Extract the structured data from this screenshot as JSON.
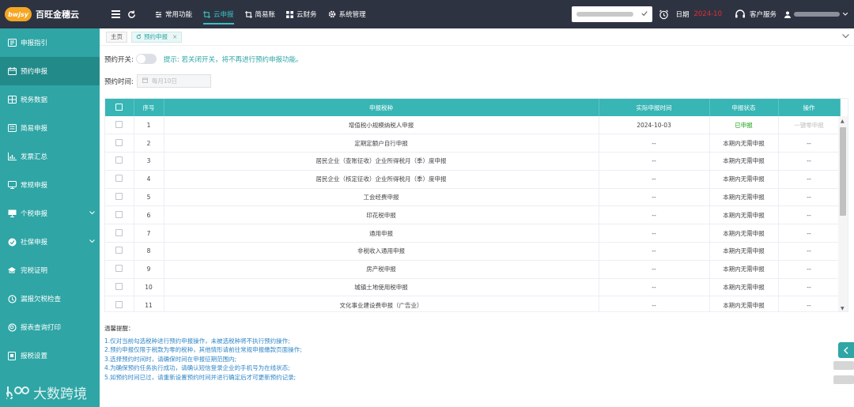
{
  "header": {
    "logo_badge": "bwjsy",
    "app_name": "百旺金穗云",
    "nav": [
      {
        "label": "常用功能",
        "icon": "tools-icon"
      },
      {
        "label": "云申报",
        "icon": "crop-icon"
      },
      {
        "label": "简易账",
        "icon": "crop-icon"
      },
      {
        "label": "云财务",
        "icon": "grid-icon"
      },
      {
        "label": "系统管理",
        "icon": "gear-icon"
      }
    ],
    "date_label": "日期",
    "date_value": "2024-10",
    "service_label": "客户服务"
  },
  "sidebar": {
    "items": [
      {
        "label": "申报指引"
      },
      {
        "label": "预约申报"
      },
      {
        "label": "税务数据"
      },
      {
        "label": "简易申报"
      },
      {
        "label": "发票汇总"
      },
      {
        "label": "常规申报"
      },
      {
        "label": "个税申报"
      },
      {
        "label": "社保申报"
      },
      {
        "label": "完税证明"
      },
      {
        "label": "漏报欠税检查"
      },
      {
        "label": "报表查询打印"
      },
      {
        "label": "报税设置"
      }
    ],
    "watermark": "大数跨境"
  },
  "tabs": [
    {
      "label": "主页"
    },
    {
      "label": "预约申报"
    }
  ],
  "form": {
    "switch_label": "预约开关:",
    "switch_hint": "提示: 若关闭开关，将不再进行预约申报功能。",
    "time_label": "预约时间:",
    "time_placeholder": "每月10日"
  },
  "table": {
    "headers": {
      "seq": "序号",
      "type": "申报税种",
      "time": "实际申报时间",
      "status": "申报状态",
      "op": "操作"
    },
    "rows": [
      {
        "seq": "1",
        "type": "增值税小规模纳税人申报",
        "time": "2024-10-03",
        "status": "已申报",
        "op": "一键零申报"
      },
      {
        "seq": "2",
        "type": "定期定额户自行申报",
        "time": "--",
        "status": "本期内无需申报",
        "op": "--"
      },
      {
        "seq": "3",
        "type": "居民企业（查账征收）企业所得税月（季）度申报",
        "time": "--",
        "status": "本期内无需申报",
        "op": "--"
      },
      {
        "seq": "4",
        "type": "居民企业（核定征收）企业所得税月（季）度申报",
        "time": "--",
        "status": "本期内无需申报",
        "op": "--"
      },
      {
        "seq": "5",
        "type": "工会经费申报",
        "time": "--",
        "status": "本期内无需申报",
        "op": "--"
      },
      {
        "seq": "6",
        "type": "印花税申报",
        "time": "--",
        "status": "本期内无需申报",
        "op": "--"
      },
      {
        "seq": "7",
        "type": "通用申报",
        "time": "--",
        "status": "本期内无需申报",
        "op": "--"
      },
      {
        "seq": "8",
        "type": "非税收入通用申报",
        "time": "--",
        "status": "本期内无需申报",
        "op": "--"
      },
      {
        "seq": "9",
        "type": "房产税申报",
        "time": "--",
        "status": "本期内无需申报",
        "op": "--"
      },
      {
        "seq": "10",
        "type": "城镇土地使用税申报",
        "time": "--",
        "status": "本期内无需申报",
        "op": "--"
      },
      {
        "seq": "11",
        "type": "文化事业建设费申报（广告业）",
        "time": "--",
        "status": "本期内无需申报",
        "op": "--"
      }
    ]
  },
  "notes": {
    "title": "温馨提醒：",
    "lines": [
      "1.仅对当前勾选税种进行预约申报操作，未被选税种将不执行预约操作;",
      "2.预约申报仅限于税款为零的税种，其他情形请前往常规申报缴款页面操作;",
      "3.选择预约时间时，请确保时间在申报征期范围内;",
      "4.为确保预约任务执行成功，请确认短信登录企业的手机号为在线状态;",
      "5.如预约时间已过，请重新设置预约时间并进行确定后才可更新预约记录;"
    ]
  },
  "colors": {
    "accent": "#2fa5a5",
    "header_bg": "#2e3342",
    "date_red": "#e03030",
    "status_ok": "#19a019"
  }
}
